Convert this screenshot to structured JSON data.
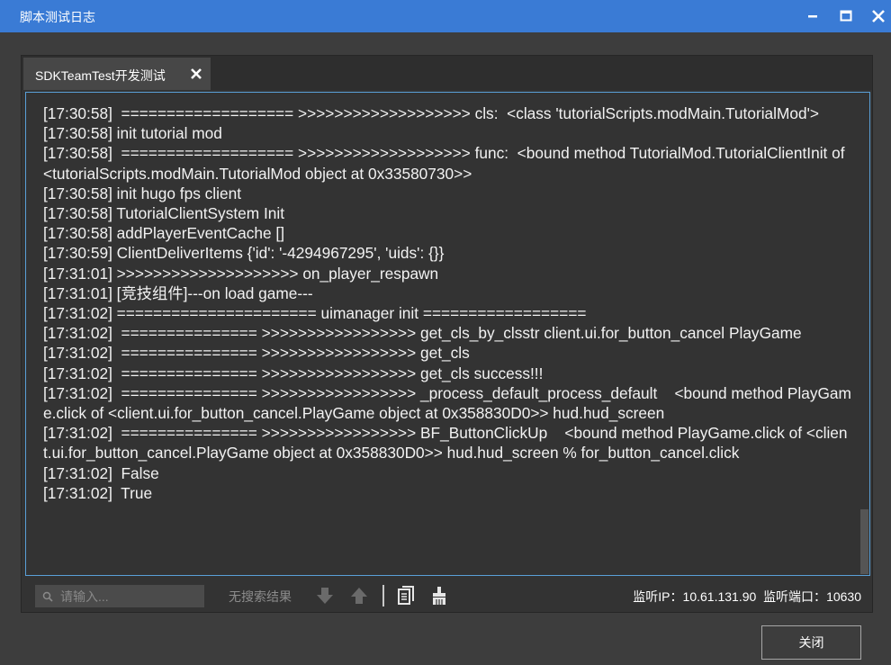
{
  "window": {
    "title": "脚本测试日志"
  },
  "tabs": [
    {
      "label": "SDKTeamTest开发测试"
    }
  ],
  "log": {
    "lines": [
      "[17:30:58]  =================== >>>>>>>>>>>>>>>>>>> cls:  <class 'tutorialScripts.modMain.TutorialMod'>",
      "[17:30:58] init tutorial mod",
      "[17:30:58]  =================== >>>>>>>>>>>>>>>>>>> func:  <bound method TutorialMod.TutorialClientInit of <tutorialScripts.modMain.TutorialMod object at 0x33580730>>",
      "[17:30:58] init hugo fps client",
      "[17:30:58] TutorialClientSystem Init",
      "[17:30:58] addPlayerEventCache []",
      "[17:30:59] ClientDeliverItems {'id': '-4294967295', 'uids': {}}",
      "[17:31:01] >>>>>>>>>>>>>>>>>>>> on_player_respawn",
      "[17:31:01] [竞技组件]---on load game---",
      "[17:31:02] ====================== uimanager init ==================",
      "[17:31:02]  =============== >>>>>>>>>>>>>>>>> get_cls_by_clsstr client.ui.for_button_cancel PlayGame",
      "[17:31:02]  =============== >>>>>>>>>>>>>>>>> get_cls",
      "[17:31:02]  =============== >>>>>>>>>>>>>>>>> get_cls success!!!",
      "[17:31:02]  =============== >>>>>>>>>>>>>>>>> _process_default_process_default    <bound method PlayGame.click of <client.ui.for_button_cancel.PlayGame object at 0x358830D0>> hud.hud_screen",
      "[17:31:02]  =============== >>>>>>>>>>>>>>>>> BF_ButtonClickUp    <bound method PlayGame.click of <client.ui.for_button_cancel.PlayGame object at 0x358830D0>> hud.hud_screen % for_button_cancel.click",
      "[17:31:02]  False",
      "[17:31:02]  True"
    ]
  },
  "search": {
    "placeholder": "请输入..."
  },
  "search_status": "无搜索结果",
  "monitor": {
    "ip_label": "监听IP：",
    "ip": "10.61.131.90",
    "port_label": "监听端口：",
    "port": "10630"
  },
  "footer": {
    "close_label": "关闭"
  },
  "icons": {
    "minimize": "minimize-icon",
    "maximize": "maximize-icon",
    "close": "close-icon",
    "tab_close": "close-icon",
    "search": "search-icon",
    "next": "arrow-down-icon",
    "prev": "arrow-up-icon",
    "copy": "copy-icon",
    "clear": "broom-icon"
  },
  "colors": {
    "titlebar": "#3a7bd5",
    "background": "#3d3d3d",
    "log_border": "#5aa0d8"
  }
}
